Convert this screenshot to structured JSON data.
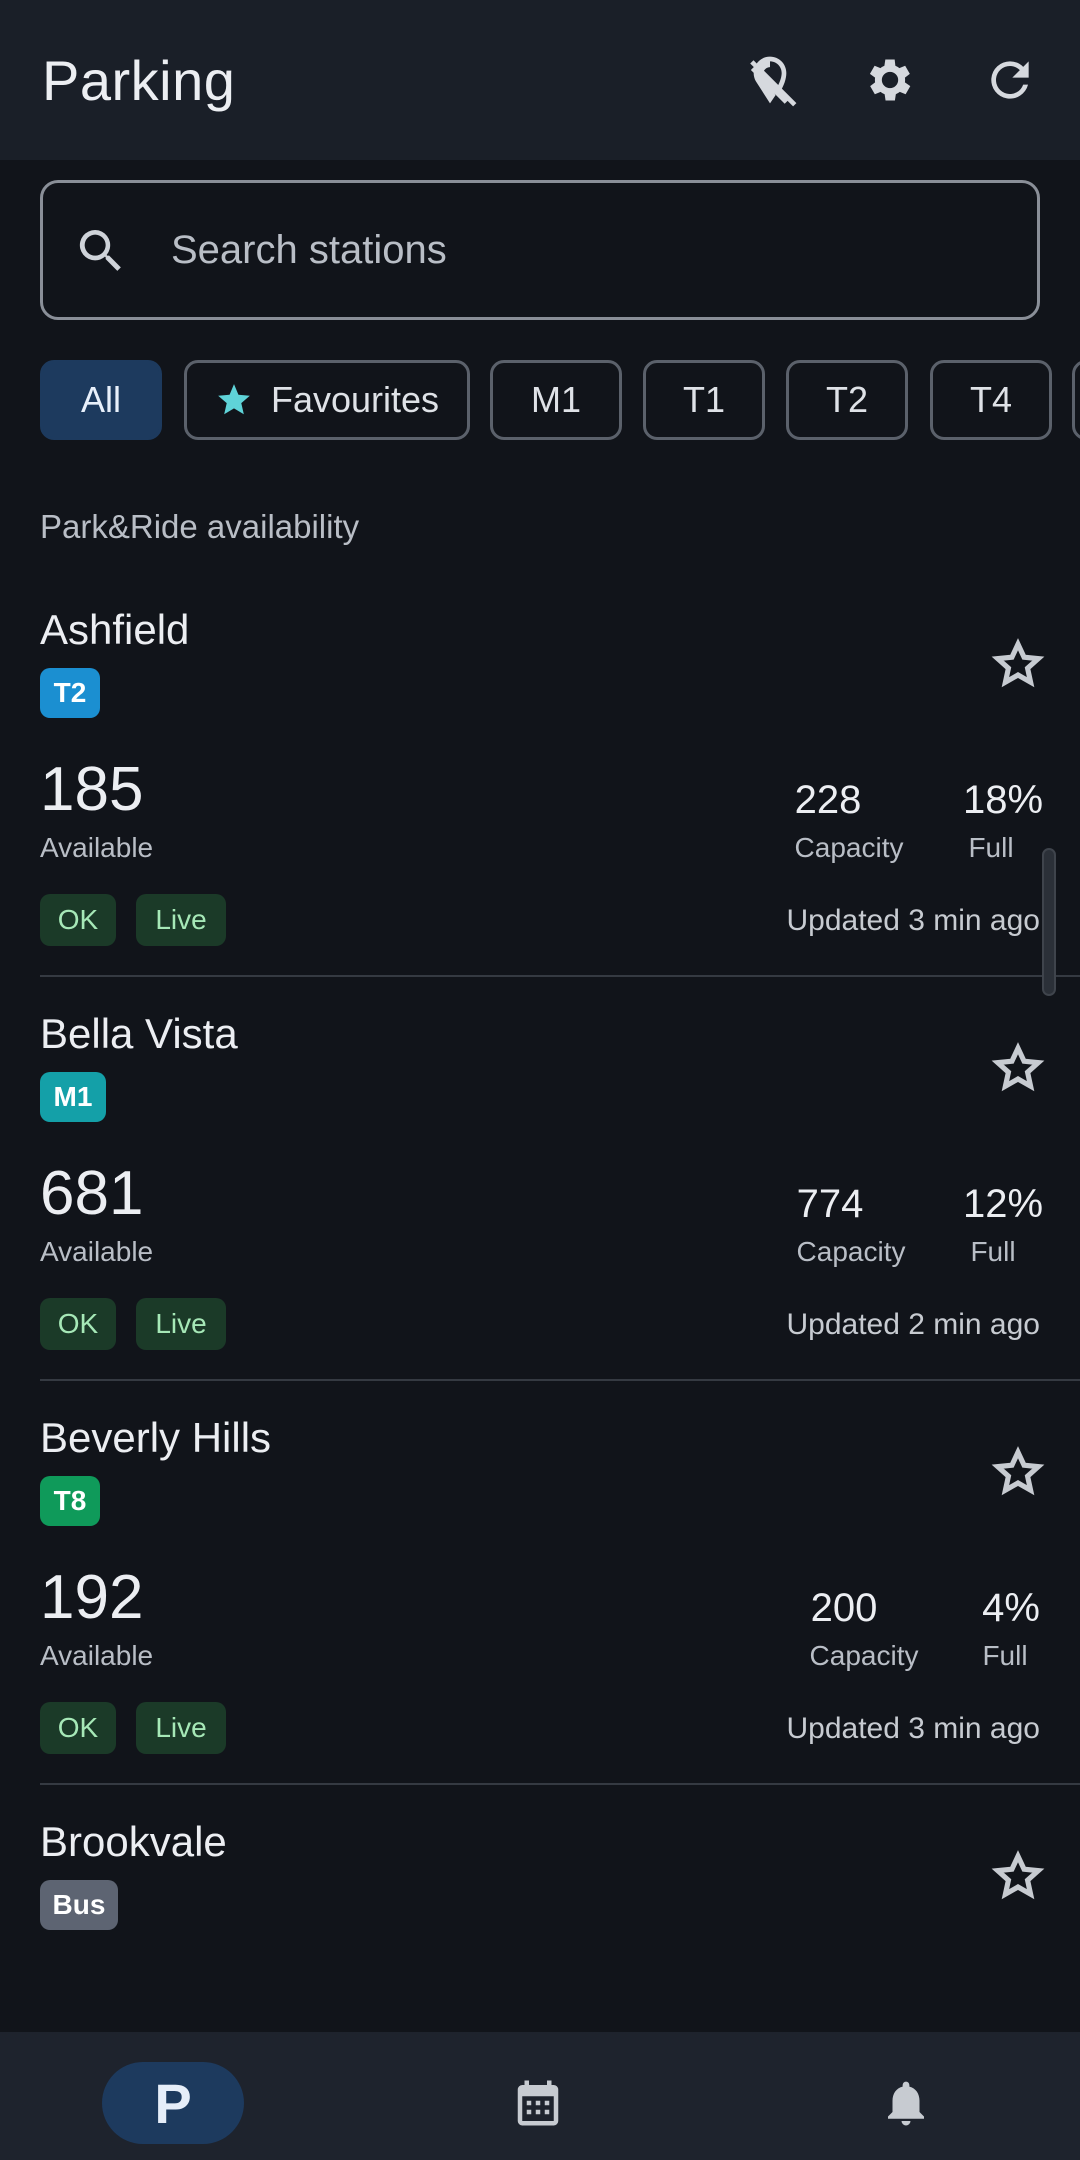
{
  "appbar": {
    "title": "Parking",
    "icons": [
      "location-off-icon",
      "gear-icon",
      "refresh-icon"
    ]
  },
  "search": {
    "placeholder": "Search stations"
  },
  "filters": {
    "chips": [
      {
        "label": "All",
        "active": true
      },
      {
        "label": "Favourites",
        "active": false,
        "icon": "star-icon"
      },
      {
        "label": "M1",
        "active": false
      },
      {
        "label": "T1",
        "active": false
      },
      {
        "label": "T2",
        "active": false
      },
      {
        "label": "T4",
        "active": false
      }
    ]
  },
  "section": {
    "title": "Park&Ride availability"
  },
  "stations": [
    {
      "name": "Ashfield",
      "line": "T2",
      "line_color": "#1b8fd1",
      "available": "185",
      "available_label": "Available",
      "capacity": "228",
      "capacity_label": "Capacity",
      "full": "18%",
      "full_label": "Full",
      "status": "OK",
      "live": "Live",
      "updated": "Updated 3 min ago"
    },
    {
      "name": "Bella Vista",
      "line": "M1",
      "line_color": "#14a0a8",
      "available": "681",
      "available_label": "Available",
      "capacity": "774",
      "capacity_label": "Capacity",
      "full": "12%",
      "full_label": "Full",
      "status": "OK",
      "live": "Live",
      "updated": "Updated 2 min ago"
    },
    {
      "name": "Beverly Hills",
      "line": "T8",
      "line_color": "#0f9a5a",
      "available": "192",
      "available_label": "Available",
      "capacity": "200",
      "capacity_label": "Capacity",
      "full": "4%",
      "full_label": "Full",
      "status": "OK",
      "live": "Live",
      "updated": "Updated 3 min ago"
    },
    {
      "name": "Brookvale",
      "line": "Bus",
      "line_color": "#5d6472"
    }
  ],
  "bottom_nav": {
    "items": [
      {
        "icon": "parking-icon",
        "letter": "P",
        "active": true
      },
      {
        "icon": "calendar-icon",
        "active": false
      },
      {
        "icon": "bell-icon",
        "active": false
      }
    ]
  },
  "colors": {
    "background": "#11141a",
    "appbar": "#1a1f28",
    "accent": "#1d3a5e",
    "ok_badge": "#1b3a28",
    "ok_text": "#a6e8b7"
  }
}
